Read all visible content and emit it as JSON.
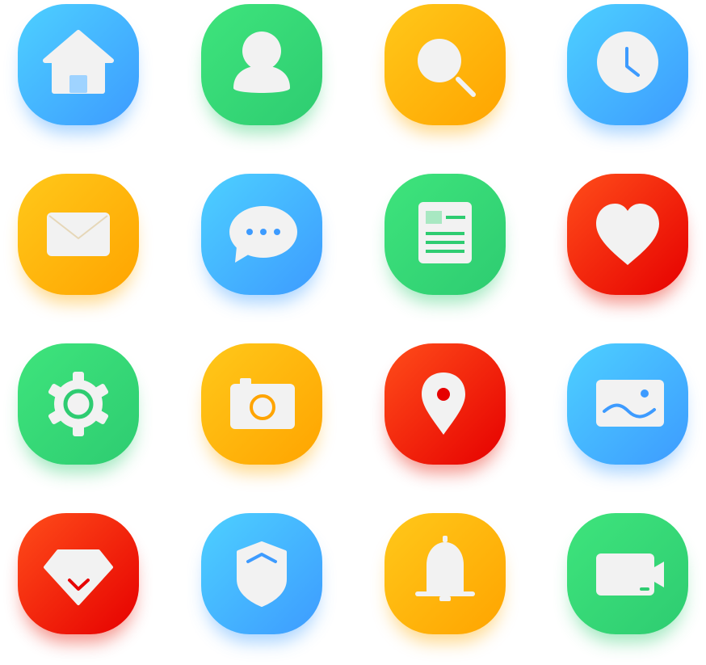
{
  "icons": [
    {
      "name": "home-icon",
      "color": "#3d9bff"
    },
    {
      "name": "user-icon",
      "color": "#2ecc71"
    },
    {
      "name": "search-icon",
      "color": "#ffa400"
    },
    {
      "name": "clock-icon",
      "color": "#3d9bff"
    },
    {
      "name": "mail-icon",
      "color": "#ffa400"
    },
    {
      "name": "chat-icon",
      "color": "#3d9bff"
    },
    {
      "name": "news-icon",
      "color": "#2ecc71"
    },
    {
      "name": "heart-icon",
      "color": "#e60000"
    },
    {
      "name": "gear-icon",
      "color": "#2ecc71"
    },
    {
      "name": "camera-icon",
      "color": "#ffa400"
    },
    {
      "name": "location-pin-icon",
      "color": "#e60000"
    },
    {
      "name": "image-icon",
      "color": "#3d9bff"
    },
    {
      "name": "diamond-icon",
      "color": "#e60000"
    },
    {
      "name": "shield-icon",
      "color": "#3d9bff"
    },
    {
      "name": "bell-icon",
      "color": "#ffa400"
    },
    {
      "name": "video-camera-icon",
      "color": "#2ecc71"
    }
  ]
}
